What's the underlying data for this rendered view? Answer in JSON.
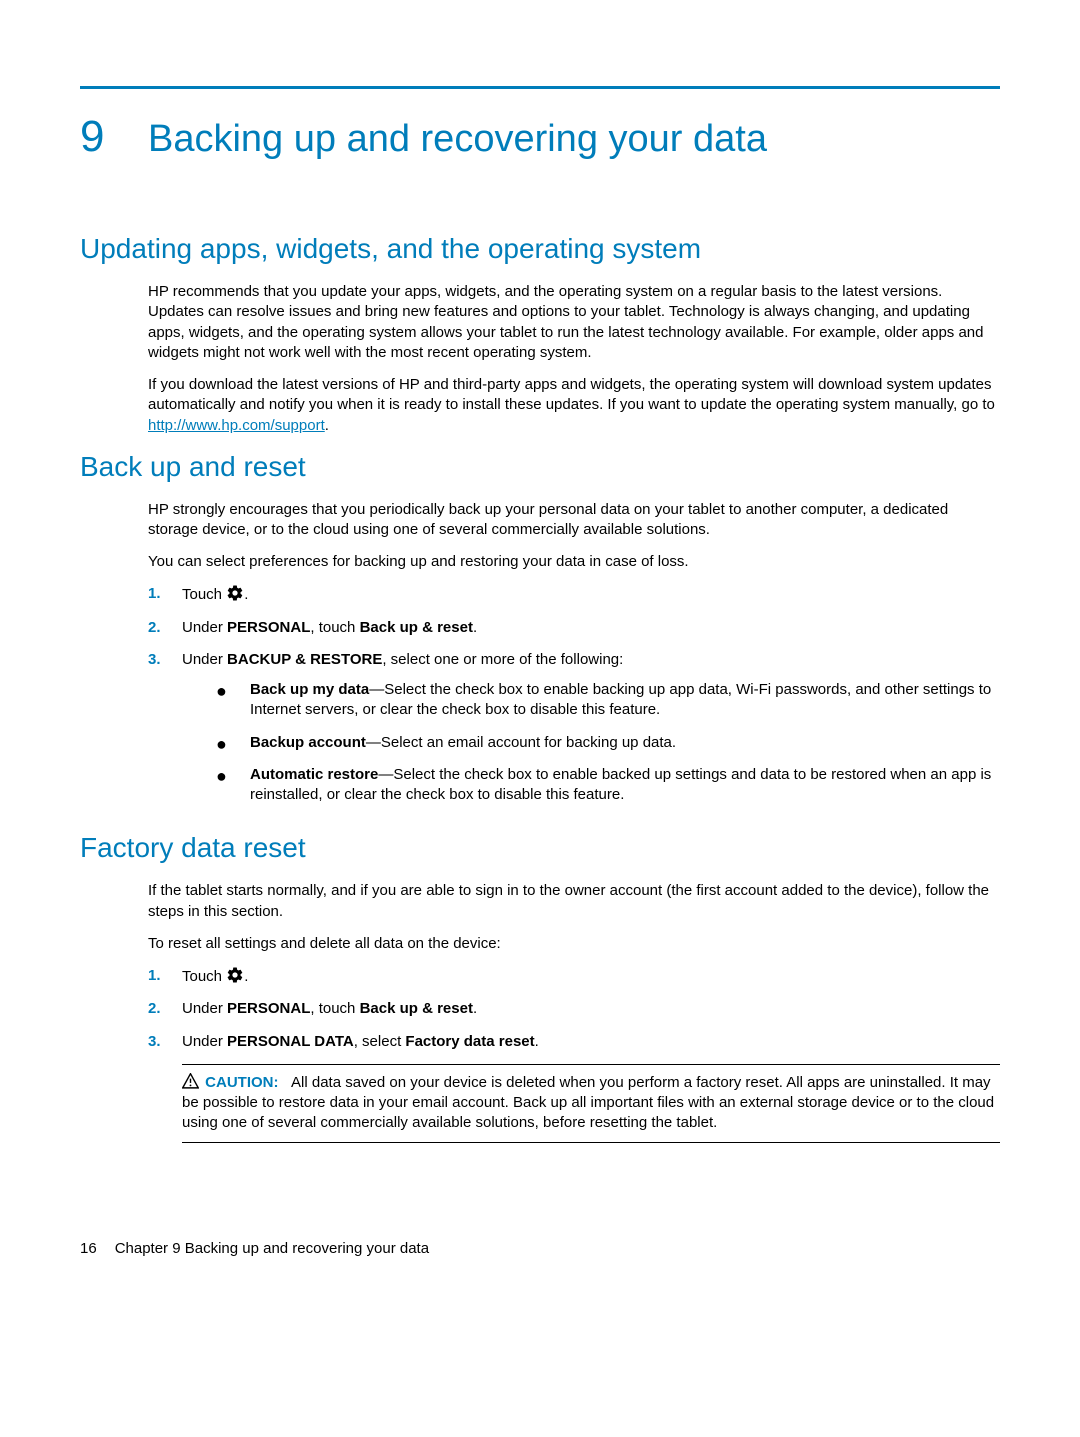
{
  "chapter": {
    "number": "9",
    "title": "Backing up and recovering your data"
  },
  "section1": {
    "heading": "Updating apps, widgets, and the operating system",
    "para1": "HP recommends that you update your apps, widgets, and the operating system on a regular basis to the latest versions. Updates can resolve issues and bring new features and options to your tablet. Technology is always changing, and updating apps, widgets, and the operating system allows your tablet to run the latest technology available. For example, older apps and widgets might not work well with the most recent operating system.",
    "para2_prefix": "If you download the latest versions of HP and third-party apps and widgets, the operating system will download system updates automatically and notify you when it is ready to install these updates. If you want to update the operating system manually, go to ",
    "para2_link": "http://www.hp.com/support",
    "para2_suffix": "."
  },
  "section2": {
    "heading": "Back up and reset",
    "para1": "HP strongly encourages that you periodically back up your personal data on your tablet to another computer, a dedicated storage device, or to the cloud using one of several commercially available solutions.",
    "para2": "You can select preferences for backing up and restoring your data in case of loss.",
    "step1_prefix": "Touch ",
    "step1_suffix": ".",
    "step2_a": "Under ",
    "step2_b": "PERSONAL",
    "step2_c": ", touch ",
    "step2_d": "Back up & reset",
    "step2_e": ".",
    "step3_a": "Under ",
    "step3_b": "BACKUP & RESTORE",
    "step3_c": ", select one or more of the following:",
    "bullet1_a": "Back up my data",
    "bullet1_b": "—Select the check box to enable backing up app data, Wi-Fi passwords, and other settings to Internet servers, or clear the check box to disable this feature.",
    "bullet2_a": "Backup account",
    "bullet2_b": "—Select an email account for backing up data.",
    "bullet3_a": "Automatic restore",
    "bullet3_b": "—Select the check box to enable backed up settings and data to be restored when an app is reinstalled, or clear the check box to disable this feature."
  },
  "section3": {
    "heading": "Factory data reset",
    "para1": "If the tablet starts normally, and if you are able to sign in to the owner account (the first account added to the device), follow the steps in this section.",
    "para2": "To reset all settings and delete all data on the device:",
    "step1_prefix": "Touch ",
    "step1_suffix": ".",
    "step2_a": "Under ",
    "step2_b": "PERSONAL",
    "step2_c": ", touch ",
    "step2_d": "Back up & reset",
    "step2_e": ".",
    "step3_a": "Under ",
    "step3_b": "PERSONAL DATA",
    "step3_c": ", select ",
    "step3_d": "Factory data reset",
    "step3_e": ".",
    "caution_label": "CAUTION:",
    "caution_text": "All data saved on your device is deleted when you perform a factory reset. All apps are uninstalled. It may be possible to restore data in your email account. Back up all important files with an external storage device or to the cloud using one of several commercially available solutions, before resetting the tablet."
  },
  "footer": {
    "page": "16",
    "text": "Chapter 9   Backing up and recovering your data"
  },
  "list_numbers": {
    "n1": "1.",
    "n2": "2.",
    "n3": "3."
  }
}
